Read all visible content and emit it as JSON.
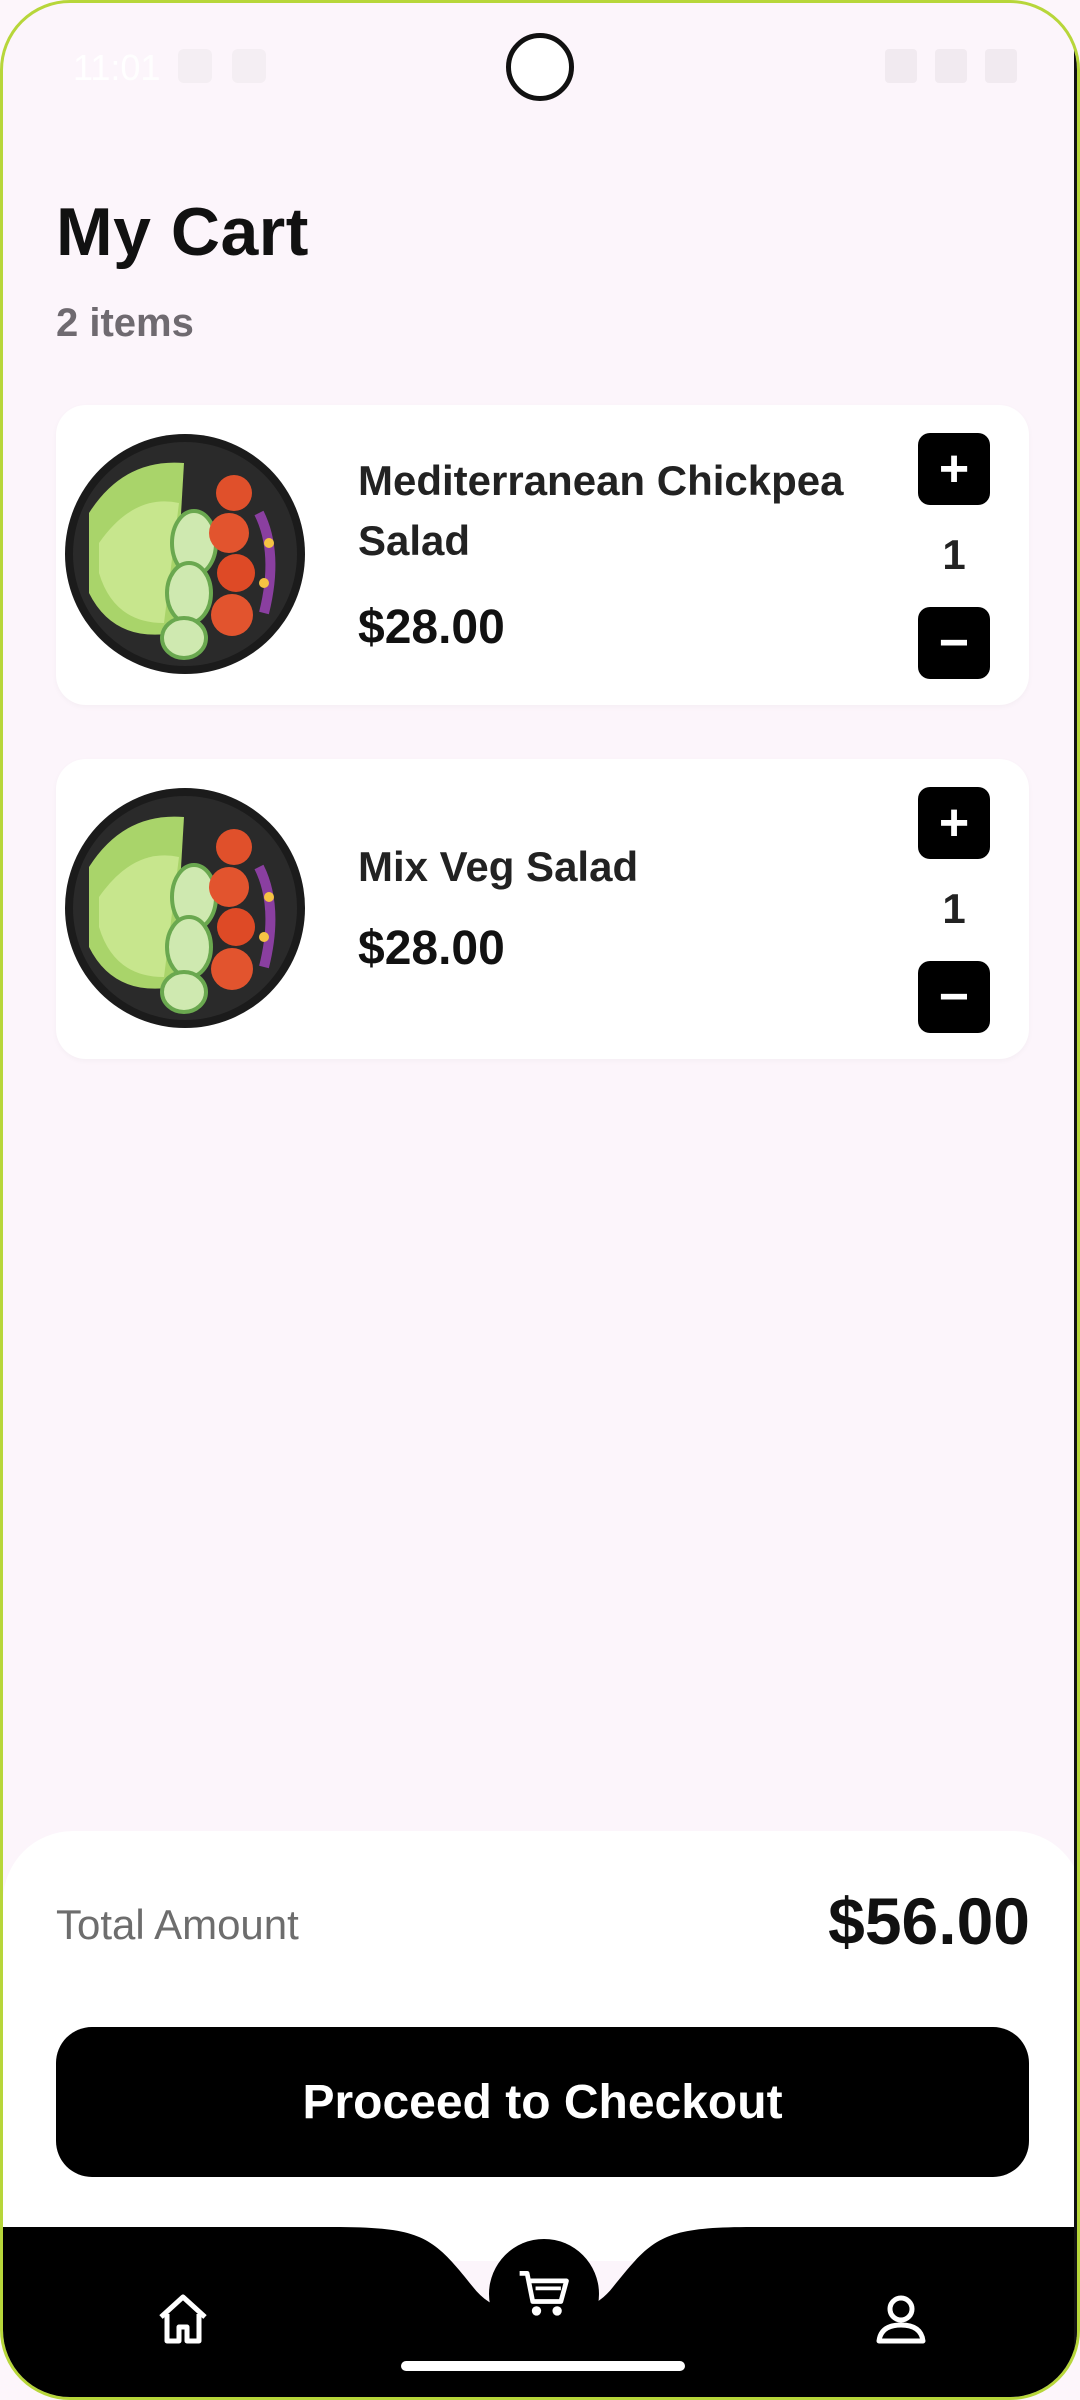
{
  "status_bar": {
    "time": "11:01"
  },
  "header": {
    "title": "My Cart",
    "item_count": "2 items"
  },
  "cart": {
    "items": [
      {
        "name": "Mediterranean Chickpea Salad",
        "price": "$28.00",
        "quantity": "1",
        "image_icon": "salad-bowl-image"
      },
      {
        "name": "Mix Veg Salad",
        "price": "$28.00",
        "quantity": "1",
        "image_icon": "salad-bowl-image"
      }
    ],
    "plus_symbol": "+",
    "minus_symbol": "−"
  },
  "summary": {
    "total_label": "Total Amount",
    "total_value": "$56.00"
  },
  "checkout": {
    "button_label": "Proceed to Checkout"
  },
  "nav": {
    "items": [
      {
        "name": "home",
        "icon": "home-icon"
      },
      {
        "name": "cart",
        "icon": "cart-icon",
        "active": true
      },
      {
        "name": "profile",
        "icon": "profile-icon"
      }
    ]
  },
  "colors": {
    "background": "#fcf5fb",
    "card": "#ffffff",
    "accent": "#000000",
    "frame": "#b7d63a"
  }
}
